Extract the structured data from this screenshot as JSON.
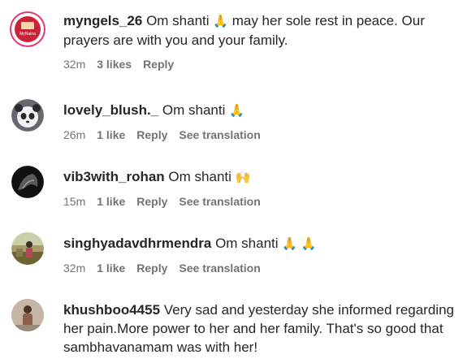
{
  "comments": [
    {
      "username": "myngels_26",
      "text": "Om shanti",
      "emoji": "🙏",
      "text_after": "may her sole rest in peace. Our prayers are with you and your family.",
      "time": "32m",
      "likes": "3 likes",
      "reply": "Reply",
      "translation": ""
    },
    {
      "username": "lovely_blush._",
      "text": "Om shanti",
      "emoji": "🙏",
      "text_after": "",
      "time": "26m",
      "likes": "1 like",
      "reply": "Reply",
      "translation": "See translation"
    },
    {
      "username": "vib3with_rohan",
      "text": "Om shanti",
      "emoji": "🙌",
      "text_after": "",
      "time": "15m",
      "likes": "1 like",
      "reply": "Reply",
      "translation": "See translation"
    },
    {
      "username": "singhyadavdhrmendra",
      "text": "Om shanti",
      "emoji": "🙏 🙏",
      "text_after": "",
      "time": "32m",
      "likes": "1 like",
      "reply": "Reply",
      "translation": "See translation"
    },
    {
      "username": "khushboo4455",
      "text": "Very sad and yesterday she informed regarding her pain.More power to her and her family. That's so good that sambhavanamam was with her!",
      "emoji": "",
      "text_after": "",
      "time": "",
      "likes": "",
      "reply": "",
      "translation": ""
    }
  ],
  "avatars": [
    {
      "icon": "brand-logo-avatar",
      "color": "#c7243a",
      "ring": "#e1306c",
      "label": "MyNaina"
    },
    {
      "icon": "panda-avatar",
      "color": "#6b6570"
    },
    {
      "icon": "dark-profile-avatar",
      "color": "#1a1a1a"
    },
    {
      "icon": "outdoor-photo-avatar",
      "color": "#7a6a3a"
    },
    {
      "icon": "person-photo-avatar",
      "color": "#8b6e5a"
    }
  ]
}
